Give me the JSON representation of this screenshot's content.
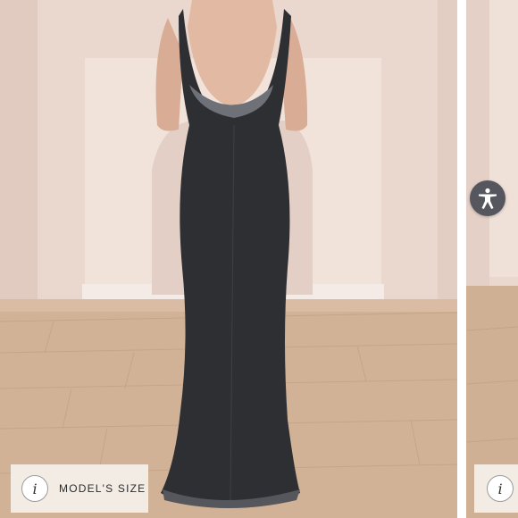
{
  "gallery": {
    "main_image_alt": "",
    "next_image_alt": ""
  },
  "size_badge": {
    "icon": "info-icon",
    "icon_glyph": "i",
    "label": "MODEL'S SIZE"
  },
  "size_badge_next": {
    "icon": "info-icon",
    "icon_glyph": "i"
  },
  "accessibility": {
    "icon": "accessibility-icon"
  }
}
